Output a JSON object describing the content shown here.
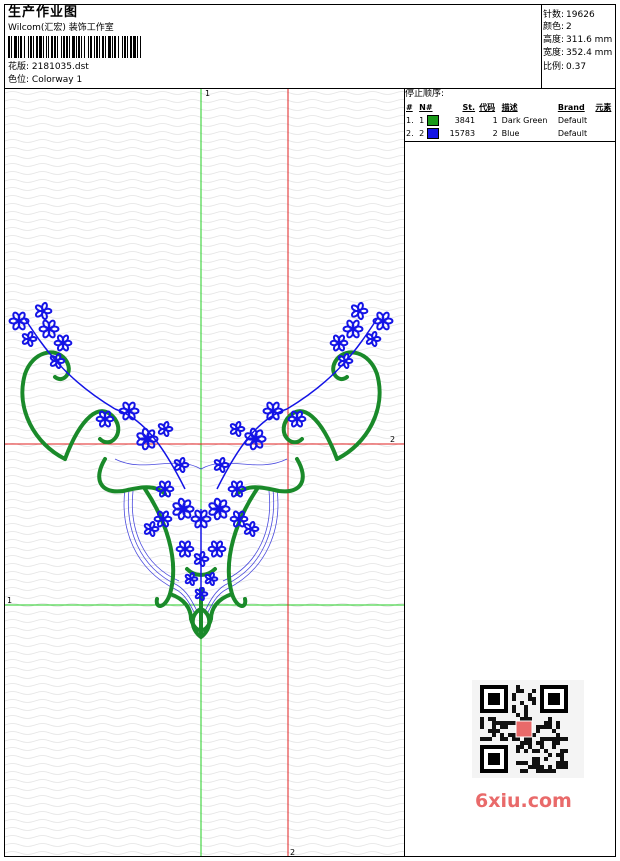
{
  "header": {
    "title": "生产作业图",
    "company": "Wilcom(汇宏) 装饰工作室",
    "design_label": "花版:",
    "design_value": "2181035.dst",
    "colorway_label": "色位:",
    "colorway_value": "Colorway 1"
  },
  "stats": [
    {
      "label": "针数:",
      "value": "19626"
    },
    {
      "label": "颜色:",
      "value": "2"
    },
    {
      "label": "高度:",
      "value": "311.6 mm"
    },
    {
      "label": "宽度:",
      "value": "352.4 mm"
    },
    {
      "label": "比例:",
      "value": "0.37"
    }
  ],
  "stop_sequence": {
    "title": "停止顺序:",
    "columns": [
      "#",
      "N#",
      "St.",
      "代码",
      "描述",
      "Brand",
      "元素"
    ],
    "rows": [
      {
        "num": "1.",
        "n": "1",
        "color": "#1a9a1a",
        "stitches": "3841",
        "code": "1",
        "desc": "Dark Green",
        "brand": "Default"
      },
      {
        "num": "2.",
        "n": "2",
        "color": "#1414e6",
        "stitches": "15783",
        "code": "2",
        "desc": "Blue",
        "brand": "Default"
      }
    ]
  },
  "guides": {
    "top_marker": "1",
    "right_marker": "2",
    "left_marker": "1",
    "bottom_marker": "2",
    "green": "#22cc22",
    "red": "#e02020"
  },
  "watermark": {
    "logo_text": "6xiu.com"
  }
}
